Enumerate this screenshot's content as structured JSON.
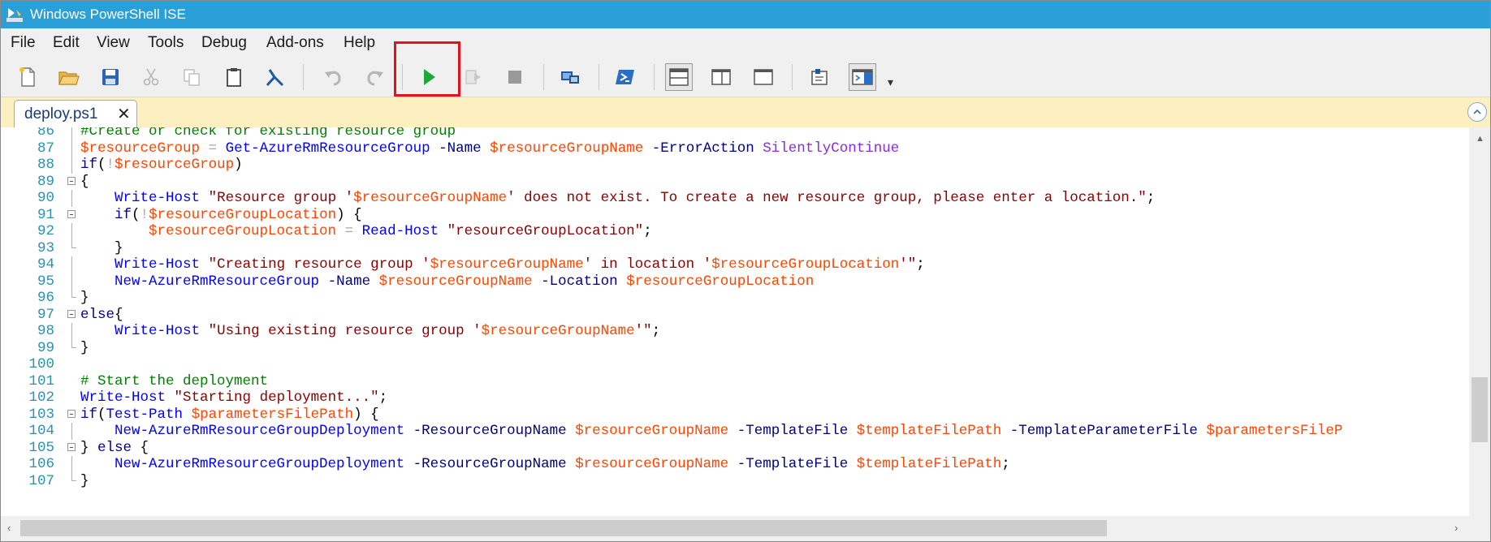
{
  "window": {
    "title": "Windows PowerShell ISE"
  },
  "menu": [
    "File",
    "Edit",
    "View",
    "Tools",
    "Debug",
    "Add-ons",
    "Help"
  ],
  "toolbar": {
    "buttons": [
      {
        "name": "new-script-button",
        "icon": "new-file-icon"
      },
      {
        "name": "open-button",
        "icon": "folder-icon"
      },
      {
        "name": "save-button",
        "icon": "save-icon"
      },
      {
        "name": "cut-button",
        "icon": "cut-icon",
        "disabled": true
      },
      {
        "name": "copy-button",
        "icon": "copy-icon",
        "disabled": true
      },
      {
        "name": "paste-button",
        "icon": "paste-icon"
      },
      {
        "name": "console-button",
        "icon": "console-icon"
      },
      {
        "name": "undo-button",
        "icon": "undo-icon",
        "disabled": true
      },
      {
        "name": "redo-button",
        "icon": "redo-icon",
        "disabled": true
      },
      {
        "name": "run-script-button",
        "icon": "play-icon",
        "highlighted": true
      },
      {
        "name": "run-selection-button",
        "icon": "run-selection-icon",
        "disabled": true
      },
      {
        "name": "stop-button",
        "icon": "stop-icon",
        "disabled": true
      },
      {
        "name": "remote-session-button",
        "icon": "remote-icon"
      },
      {
        "name": "powershell-button",
        "icon": "powershell-icon"
      },
      {
        "name": "layout-top-button",
        "icon": "layout-top-icon",
        "active": true
      },
      {
        "name": "layout-right-button",
        "icon": "layout-right-icon"
      },
      {
        "name": "layout-max-button",
        "icon": "layout-max-icon"
      },
      {
        "name": "show-script-button",
        "icon": "show-script-icon"
      },
      {
        "name": "command-addon-button",
        "icon": "command-addon-icon",
        "active": true
      }
    ],
    "overflow_label": "▾"
  },
  "tabs": [
    {
      "label": "deploy.ps1",
      "close": "✕"
    }
  ],
  "colors": {
    "titlebar": "#2b9fd8",
    "tabstrip": "#fdf0c0",
    "comment": "#008000",
    "variable": "#ff4500",
    "command": "#0000ff",
    "parameter": "#000080",
    "string": "#8b0000",
    "keyword": "#00008b",
    "operator": "#a9a9a9",
    "type": "#8a2be2",
    "highlight": "#e0141e"
  },
  "editor": {
    "lines": [
      {
        "num": "86",
        "fold": "line",
        "tokens": [
          [
            "c",
            "#Create or check for existing resource group"
          ]
        ]
      },
      {
        "num": "87",
        "fold": "line",
        "tokens": [
          [
            "v",
            "$resourceGroup"
          ],
          [
            "p",
            " "
          ],
          [
            "o",
            "="
          ],
          [
            "p",
            " "
          ],
          [
            "m",
            "Get-AzureRmResourceGroup"
          ],
          [
            "p",
            " "
          ],
          [
            "a",
            "-Name"
          ],
          [
            "p",
            " "
          ],
          [
            "v",
            "$resourceGroupName"
          ],
          [
            "p",
            " "
          ],
          [
            "a",
            "-ErrorAction"
          ],
          [
            "p",
            " "
          ],
          [
            "t",
            "SilentlyContinue"
          ]
        ]
      },
      {
        "num": "88",
        "fold": "line",
        "tokens": [
          [
            "k",
            "if"
          ],
          [
            "p",
            "("
          ],
          [
            "o",
            "!"
          ],
          [
            "v",
            "$resourceGroup"
          ],
          [
            "p",
            ")"
          ]
        ]
      },
      {
        "num": "89",
        "fold": "box",
        "tokens": [
          [
            "p",
            "{"
          ]
        ]
      },
      {
        "num": "90",
        "fold": "line",
        "tokens": [
          [
            "p",
            "    "
          ],
          [
            "m",
            "Write-Host"
          ],
          [
            "p",
            " "
          ],
          [
            "s",
            "\"Resource group '"
          ],
          [
            "v",
            "$resourceGroupName"
          ],
          [
            "s",
            "' does not exist. To create a new resource group, please enter a location.\""
          ],
          [
            "p",
            ";"
          ]
        ]
      },
      {
        "num": "91",
        "fold": "box",
        "tokens": [
          [
            "p",
            "    "
          ],
          [
            "k",
            "if"
          ],
          [
            "p",
            "("
          ],
          [
            "o",
            "!"
          ],
          [
            "v",
            "$resourceGroupLocation"
          ],
          [
            "p",
            ") {"
          ]
        ]
      },
      {
        "num": "92",
        "fold": "line",
        "tokens": [
          [
            "p",
            "        "
          ],
          [
            "v",
            "$resourceGroupLocation"
          ],
          [
            "p",
            " "
          ],
          [
            "o",
            "="
          ],
          [
            "p",
            " "
          ],
          [
            "m",
            "Read-Host"
          ],
          [
            "p",
            " "
          ],
          [
            "s",
            "\"resourceGroupLocation\""
          ],
          [
            "p",
            ";"
          ]
        ]
      },
      {
        "num": "93",
        "fold": "end",
        "tokens": [
          [
            "p",
            "    }"
          ]
        ]
      },
      {
        "num": "94",
        "fold": "line",
        "tokens": [
          [
            "p",
            "    "
          ],
          [
            "m",
            "Write-Host"
          ],
          [
            "p",
            " "
          ],
          [
            "s",
            "\"Creating resource group '"
          ],
          [
            "v",
            "$resourceGroupName"
          ],
          [
            "s",
            "' in location '"
          ],
          [
            "v",
            "$resourceGroupLocation"
          ],
          [
            "s",
            "'\""
          ],
          [
            "p",
            ";"
          ]
        ]
      },
      {
        "num": "95",
        "fold": "line",
        "tokens": [
          [
            "p",
            "    "
          ],
          [
            "m",
            "New-AzureRmResourceGroup"
          ],
          [
            "p",
            " "
          ],
          [
            "a",
            "-Name"
          ],
          [
            "p",
            " "
          ],
          [
            "v",
            "$resourceGroupName"
          ],
          [
            "p",
            " "
          ],
          [
            "a",
            "-Location"
          ],
          [
            "p",
            " "
          ],
          [
            "v",
            "$resourceGroupLocation"
          ]
        ]
      },
      {
        "num": "96",
        "fold": "end",
        "tokens": [
          [
            "p",
            "}"
          ]
        ]
      },
      {
        "num": "97",
        "fold": "box",
        "tokens": [
          [
            "k",
            "else"
          ],
          [
            "p",
            "{"
          ]
        ]
      },
      {
        "num": "98",
        "fold": "line",
        "tokens": [
          [
            "p",
            "    "
          ],
          [
            "m",
            "Write-Host"
          ],
          [
            "p",
            " "
          ],
          [
            "s",
            "\"Using existing resource group '"
          ],
          [
            "v",
            "$resourceGroupName"
          ],
          [
            "s",
            "'\""
          ],
          [
            "p",
            ";"
          ]
        ]
      },
      {
        "num": "99",
        "fold": "end",
        "tokens": [
          [
            "p",
            "}"
          ]
        ]
      },
      {
        "num": "100",
        "fold": "none",
        "tokens": []
      },
      {
        "num": "101",
        "fold": "none",
        "tokens": [
          [
            "c",
            "# Start the deployment"
          ]
        ]
      },
      {
        "num": "102",
        "fold": "none",
        "tokens": [
          [
            "m",
            "Write-Host"
          ],
          [
            "p",
            " "
          ],
          [
            "s",
            "\"Starting deployment...\""
          ],
          [
            "p",
            ";"
          ]
        ]
      },
      {
        "num": "103",
        "fold": "box",
        "tokens": [
          [
            "k",
            "if"
          ],
          [
            "p",
            "("
          ],
          [
            "m",
            "Test-Path"
          ],
          [
            "p",
            " "
          ],
          [
            "v",
            "$parametersFilePath"
          ],
          [
            "p",
            ") {"
          ]
        ]
      },
      {
        "num": "104",
        "fold": "line",
        "tokens": [
          [
            "p",
            "    "
          ],
          [
            "m",
            "New-AzureRmResourceGroupDeployment"
          ],
          [
            "p",
            " "
          ],
          [
            "a",
            "-ResourceGroupName"
          ],
          [
            "p",
            " "
          ],
          [
            "v",
            "$resourceGroupName"
          ],
          [
            "p",
            " "
          ],
          [
            "a",
            "-TemplateFile"
          ],
          [
            "p",
            " "
          ],
          [
            "v",
            "$templateFilePath"
          ],
          [
            "p",
            " "
          ],
          [
            "a",
            "-TemplateParameterFile"
          ],
          [
            "p",
            " "
          ],
          [
            "v",
            "$parametersFileP"
          ]
        ]
      },
      {
        "num": "105",
        "fold": "box",
        "tokens": [
          [
            "p",
            "} "
          ],
          [
            "k",
            "else"
          ],
          [
            "p",
            " {"
          ]
        ]
      },
      {
        "num": "106",
        "fold": "line",
        "tokens": [
          [
            "p",
            "    "
          ],
          [
            "m",
            "New-AzureRmResourceGroupDeployment"
          ],
          [
            "p",
            " "
          ],
          [
            "a",
            "-ResourceGroupName"
          ],
          [
            "p",
            " "
          ],
          [
            "v",
            "$resourceGroupName"
          ],
          [
            "p",
            " "
          ],
          [
            "a",
            "-TemplateFile"
          ],
          [
            "p",
            " "
          ],
          [
            "v",
            "$templateFilePath"
          ],
          [
            "p",
            ";"
          ]
        ]
      },
      {
        "num": "107",
        "fold": "end",
        "tokens": [
          [
            "p",
            "}"
          ]
        ]
      }
    ]
  }
}
